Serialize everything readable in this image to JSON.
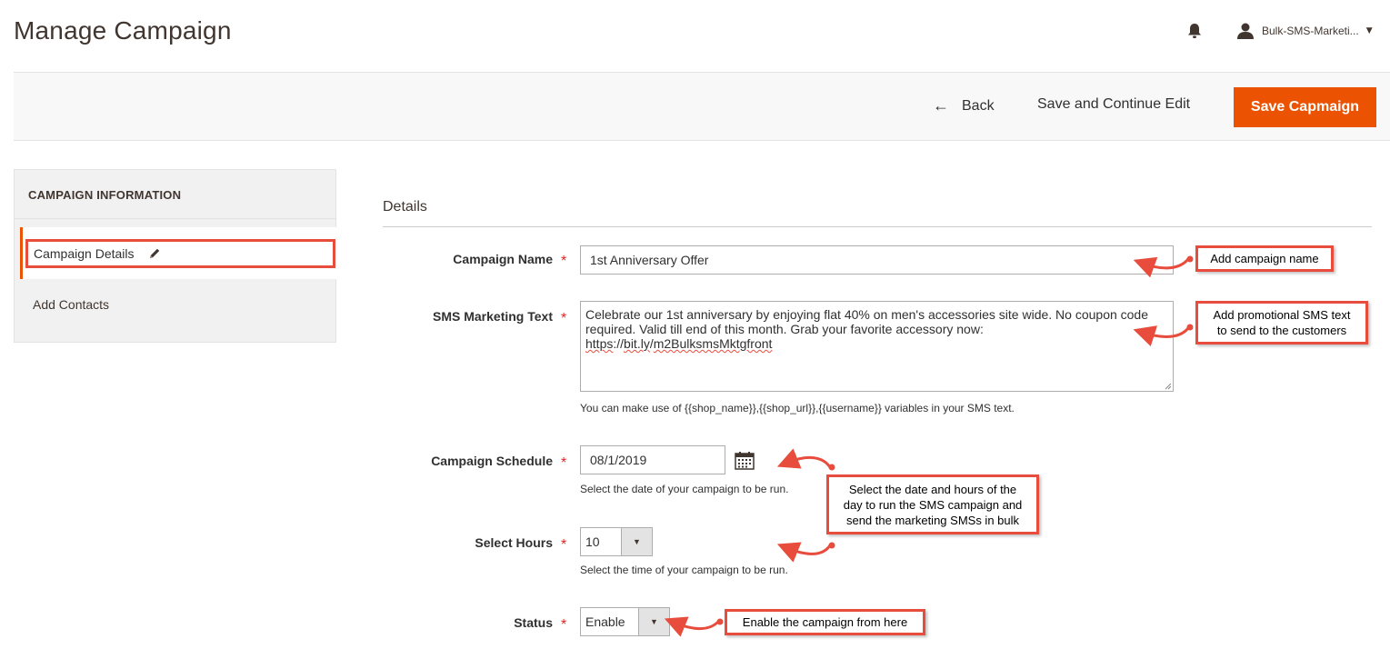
{
  "header": {
    "page_title": "Manage Campaign",
    "user_name": "Bulk-SMS-Marketi...",
    "user_caret": "▼",
    "icons": {
      "bell": "bell-icon",
      "user": "user-icon"
    }
  },
  "actions": {
    "back_arrow": "←",
    "back_label": "Back",
    "save_continue_label": "Save and Continue Edit",
    "save_label": "Save Capmaign",
    "accent_color": "#eb5202"
  },
  "sidebar": {
    "title": "CAMPAIGN INFORMATION",
    "items": [
      {
        "label": "Campaign Details",
        "active": true,
        "icon": "pencil-icon"
      },
      {
        "label": "Add Contacts",
        "active": false
      }
    ]
  },
  "form": {
    "section_title": "Details",
    "required_mark": "*",
    "campaign_name": {
      "label": "Campaign Name",
      "value": "1st Anniversary Offer"
    },
    "sms_text": {
      "label": "SMS Marketing Text",
      "value_line1": "Celebrate our 1st anniversary by enjoying flat 40% on men's accessories site wide. No coupon code",
      "value_line2": "required. Valid till end of this month. Grab your favorite accessory now:",
      "value_link_a": "https",
      "value_link_b": "://",
      "value_link_c": "bit.ly",
      "value_link_d": "/",
      "value_link_e": "m2BulksmsMktgfront",
      "note": "You can make use of {{shop_name}},{{shop_url}},{{username}} variables in your SMS text."
    },
    "schedule": {
      "label": "Campaign Schedule",
      "value": "08/1/2019",
      "note": "Select the date of your campaign to be run.",
      "icon": "calendar-icon"
    },
    "hours": {
      "label": "Select Hours",
      "value": "10",
      "caret": "▼",
      "note": "Select the time of your campaign to be run."
    },
    "status": {
      "label": "Status",
      "value": "Enable",
      "caret": "▼"
    }
  },
  "callouts": {
    "name": "Add campaign name",
    "sms_line1": "Add promotional SMS text",
    "sms_line2": "to send to the customers",
    "schedule_line1": "Select the date and hours of the",
    "schedule_line2": "day to run the SMS campaign and",
    "schedule_line3": "send the marketing SMSs in bulk",
    "status": "Enable the campaign from here",
    "border_color": "#e84c3d"
  }
}
